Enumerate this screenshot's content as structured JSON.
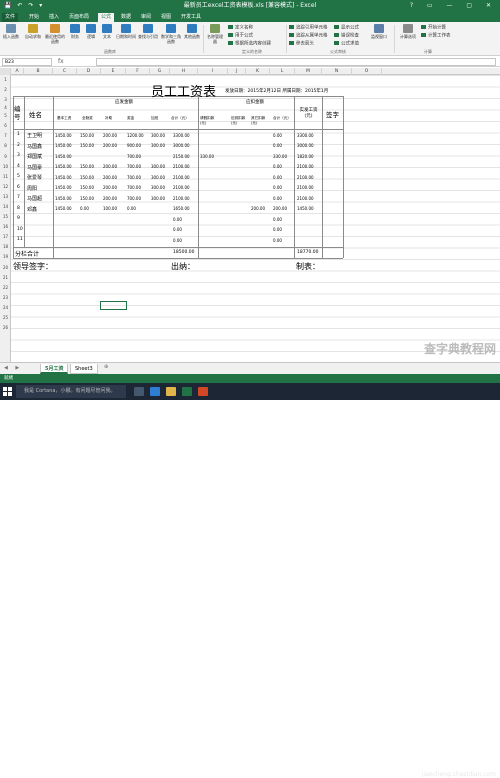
{
  "window": {
    "title": "最新员工excel工资表模板.xls [兼容模式] - Excel",
    "controls": [
      "?",
      "▭",
      "—",
      "▢",
      "✕"
    ]
  },
  "ribbon_tabs": [
    "文件",
    "开始",
    "插入",
    "页面布局",
    "公式",
    "数据",
    "审阅",
    "视图",
    "开发工具"
  ],
  "ribbon": {
    "buttons": [
      "插入函数",
      "自动求和",
      "最近使用的函数",
      "财务",
      "逻辑",
      "文本",
      "日期和时间",
      "查找与引用",
      "数学和三角函数",
      "其他函数",
      "名称管理器",
      "监视窗口",
      "计算选项"
    ],
    "name_items": [
      "定义名称",
      "用于公式",
      "根据所选内容创建"
    ],
    "audit_items": [
      "追踪引用单元格",
      "追踪从属单元格",
      "移去箭头",
      "显示公式",
      "错误检查",
      "公式求值"
    ],
    "calc_items": [
      "开始计算",
      "计算工作表"
    ],
    "groups": [
      "函数库",
      "定义的名称",
      "公式审核",
      "计算"
    ]
  },
  "formula_bar": {
    "name_box": "B23",
    "fx": "fx",
    "value": ""
  },
  "columns": [
    "A",
    "B",
    "C",
    "D",
    "E",
    "F",
    "G",
    "H",
    "I",
    "J",
    "K",
    "L",
    "M",
    "N",
    "O"
  ],
  "rows": [
    "1",
    "2",
    "3",
    "4",
    "5",
    "6",
    "7",
    "8",
    "9",
    "10",
    "11",
    "12",
    "13",
    "14",
    "15",
    "16",
    "17",
    "18",
    "19",
    "20",
    "21",
    "22",
    "23",
    "24",
    "25",
    "26"
  ],
  "sheet": {
    "title": "员工工资表",
    "issue_date": "发放日期：2015年2月12日 所属日期：2015年1月",
    "headers": {
      "num": "编号",
      "name": "姓名",
      "payable_group": "应发金额",
      "payable_cols": [
        "基本工资",
        "全勤奖",
        "补助",
        "奖金",
        "加班",
        "合计（元）"
      ],
      "deduct_group": "应扣金额",
      "deduct_cols": [
        "请假扣款(元)",
        "迟到扣款(元)",
        "其它扣款(元)",
        "合计（元）"
      ],
      "actual": "实发工资(元)",
      "sign": "签字"
    },
    "rows": [
      {
        "no": "1",
        "name": "王卫明",
        "cells": [
          "1450.00",
          "150.00",
          "200.00",
          "1200.00",
          "300.00",
          "3300.00",
          "",
          "",
          "",
          "0.00",
          "3300.00"
        ]
      },
      {
        "no": "2",
        "name": "马国鑫",
        "cells": [
          "1450.00",
          "150.00",
          "200.00",
          "900.00",
          "300.00",
          "3000.00",
          "",
          "",
          "",
          "0.00",
          "3000.00"
        ]
      },
      {
        "no": "3",
        "name": "郑国斌",
        "cells": [
          "1450.00",
          "",
          "",
          "700.00",
          "",
          "2150.00",
          "330.00",
          "",
          "",
          "330.00",
          "1820.00"
        ]
      },
      {
        "no": "4",
        "name": "马国豪",
        "cells": [
          "1450.00",
          "150.00",
          "200.00",
          "700.00",
          "300.00",
          "2100.00",
          "",
          "",
          "",
          "0.00",
          "2100.00"
        ]
      },
      {
        "no": "5",
        "name": "张爱琴",
        "cells": [
          "1450.00",
          "150.00",
          "200.00",
          "700.00",
          "300.00",
          "2100.00",
          "",
          "",
          "",
          "0.00",
          "2100.00"
        ]
      },
      {
        "no": "6",
        "name": "周阳",
        "cells": [
          "1450.00",
          "150.00",
          "200.00",
          "700.00",
          "300.00",
          "2100.00",
          "",
          "",
          "",
          "0.00",
          "2100.00"
        ]
      },
      {
        "no": "7",
        "name": "马国超",
        "cells": [
          "1450.00",
          "150.00",
          "200.00",
          "700.00",
          "300.00",
          "2100.00",
          "",
          "",
          "",
          "0.00",
          "2100.00"
        ]
      },
      {
        "no": "8",
        "name": "邓鑫",
        "cells": [
          "1450.00",
          "0.00",
          "100.00",
          "0.00",
          "",
          "1650.00",
          "",
          "",
          "200.00",
          "200.00",
          "1450.00"
        ]
      },
      {
        "no": "9",
        "name": "",
        "cells": [
          "",
          "",
          "",
          "",
          "",
          "0.00",
          "",
          "",
          "",
          "0.00",
          ""
        ]
      },
      {
        "no": "10",
        "name": "",
        "cells": [
          "",
          "",
          "",
          "",
          "",
          "0.00",
          "",
          "",
          "",
          "0.00",
          ""
        ]
      },
      {
        "no": "11",
        "name": "",
        "cells": [
          "",
          "",
          "",
          "",
          "",
          "0.00",
          "",
          "",
          "",
          "0.00",
          ""
        ]
      }
    ],
    "subtotal_label": "分栏合计",
    "subtotal_payable": "18500.00",
    "subtotal_actual": "18770.00",
    "footer": [
      "领导签字：",
      "出纳：",
      "制表："
    ]
  },
  "sheet_tabs": [
    "5月工资",
    "Sheet3"
  ],
  "status_text": "就绪",
  "taskbar": {
    "search_placeholder": "我是 Cortana，小娜。有问题尽管问我。"
  },
  "watermark": "查字典教程网",
  "watermark_url": "jiaocheng.chazidian.com",
  "colors": {
    "excel_green": "#217346",
    "taskbar": "#1c2634"
  }
}
